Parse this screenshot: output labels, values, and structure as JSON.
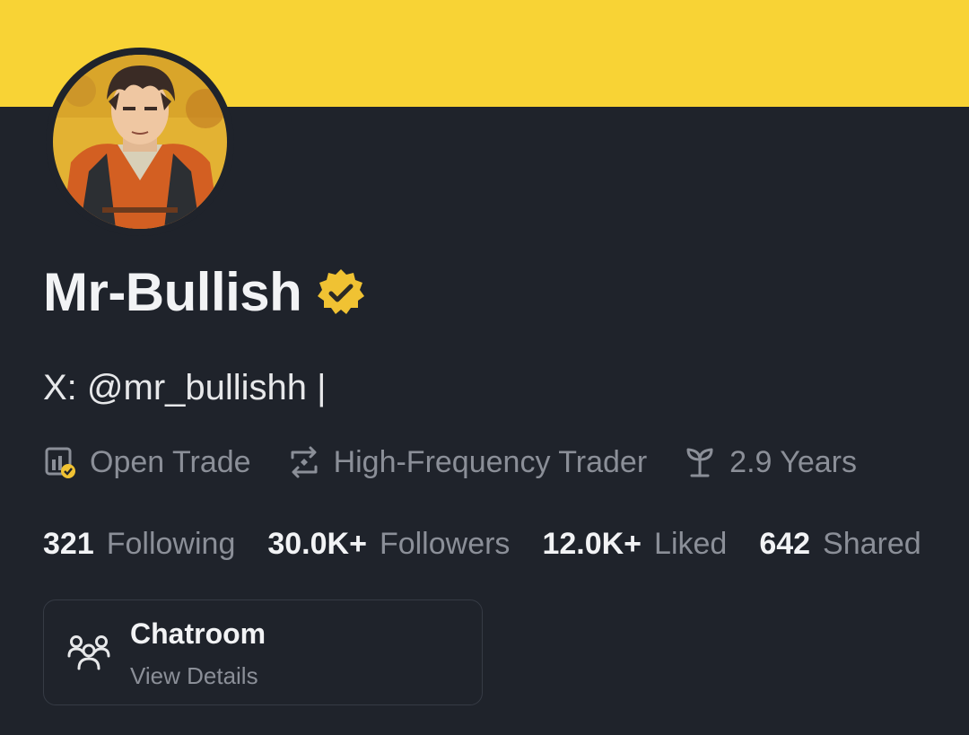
{
  "colors": {
    "banner": "#f8d335",
    "background": "#1f232b",
    "badge": "#f0c233"
  },
  "profile": {
    "name": "Mr-Bullish",
    "bio": "X: @mr_bullishh |",
    "verified": true
  },
  "tags": [
    {
      "icon": "open-trade-icon",
      "label": "Open Trade"
    },
    {
      "icon": "swap-icon",
      "label": "High-Frequency Trader"
    },
    {
      "icon": "sprout-icon",
      "label": "2.9 Years"
    }
  ],
  "stats": [
    {
      "value": "321",
      "label": "Following"
    },
    {
      "value": "30.0K+",
      "label": "Followers"
    },
    {
      "value": "12.0K+",
      "label": "Liked"
    },
    {
      "value": "642",
      "label": "Shared"
    }
  ],
  "chatroom": {
    "icon": "group-icon",
    "title": "Chatroom",
    "subtitle": "View Details"
  }
}
